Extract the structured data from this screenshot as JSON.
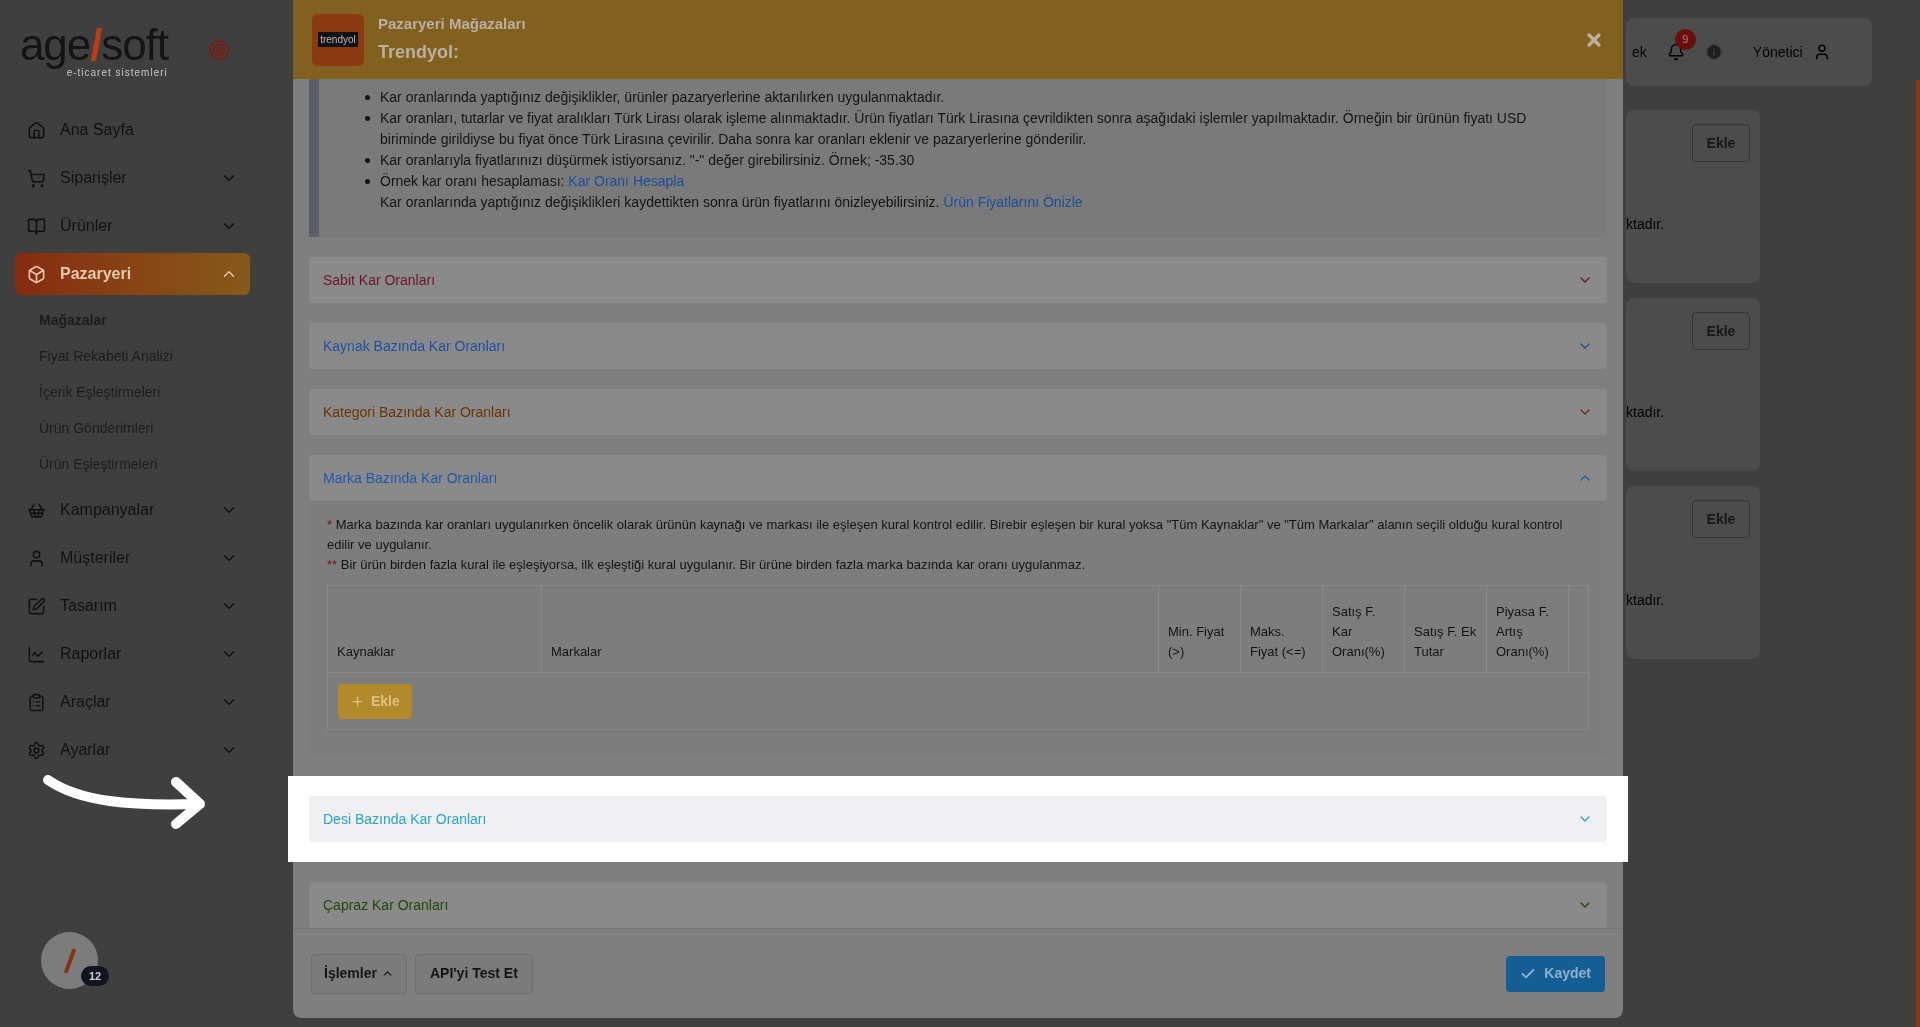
{
  "sidebar": {
    "logo": {
      "part_1": "age",
      "slash": "/",
      "part_2": "soft",
      "tagline": "e-ticaret sistemleri"
    },
    "items": [
      {
        "label": "Ana Sayfa",
        "kind": "link",
        "selected": false
      },
      {
        "label": "Siparişler",
        "kind": "group",
        "selected": false,
        "expanded": false
      },
      {
        "label": "Ürünler",
        "kind": "group",
        "selected": false,
        "expanded": false
      },
      {
        "label": "Pazaryeri",
        "kind": "group",
        "selected": true,
        "expanded": true,
        "children": [
          {
            "label": "Mağazalar",
            "selected": true
          },
          {
            "label": "Fiyat Rekabeti Analizi",
            "selected": false
          },
          {
            "label": "İçerik Eşleştirmeleri",
            "selected": false
          },
          {
            "label": "Ürün Gönderimleri",
            "selected": false
          },
          {
            "label": "Ürün Eşleştirmeleri",
            "selected": false
          }
        ]
      },
      {
        "label": "Kampanyalar",
        "kind": "group",
        "selected": false,
        "expanded": false
      },
      {
        "label": "Müşteriler",
        "kind": "group",
        "selected": false,
        "expanded": false
      },
      {
        "label": "Tasarım",
        "kind": "group",
        "selected": false,
        "expanded": false
      },
      {
        "label": "Raporlar",
        "kind": "group",
        "selected": false,
        "expanded": false
      },
      {
        "label": "Araçlar",
        "kind": "group",
        "selected": false,
        "expanded": false
      },
      {
        "label": "Ayarlar",
        "kind": "group",
        "selected": false,
        "expanded": false
      }
    ]
  },
  "floating_widget": {
    "badge": "12"
  },
  "background_page": {
    "topbar": {
      "cut_text": "ek",
      "notification_count": "9",
      "user": "Yönetici"
    },
    "cards": [
      {
        "button": "Ekle",
        "cut_text": "ktadır."
      },
      {
        "button": "Ekle",
        "cut_text": "ktadır."
      },
      {
        "button": "Ekle",
        "cut_text": "ktadır."
      }
    ]
  },
  "modal": {
    "logo_text": "trendyol",
    "subtitle": "Pazaryeri Mağazaları",
    "title": "Trendyol:",
    "notes": [
      {
        "lines": [
          {
            "text": "Kar oranlarında yaptığınız değişiklikler, ürünler pazaryerlerine aktarılırken uygulanmaktadır."
          }
        ]
      },
      {
        "lines": [
          {
            "text": "Kar oranları, tutarlar ve fiyat aralıkları Türk Lirası olarak işleme alınmaktadır. Ürün fiyatları Türk Lirasına çevrildikten sonra aşağıdaki işlemler yapılmaktadır. Örneğin bir ürünün fiyatı USD biriminde girildiyse bu fiyat önce Türk Lirasına çevirilir. Daha sonra kar oranları eklenir ve pazaryerlerine gönderilir."
          }
        ]
      },
      {
        "lines": [
          {
            "text": "Kar oranlarıyla fiyatlarınızı düşürmek istiyorsanız. \"-\" değer girebilirsiniz. Örnek; -35.30"
          }
        ]
      },
      {
        "lines": [
          {
            "text": "Örnek kar oranı hesaplaması:",
            "link": "Kar Oranı Hesapla"
          },
          {
            "text": "Kar oranlarında yaptığınız değişiklikleri kaydettikten sonra ürün fiyatlarını önizleyebilirsiniz.",
            "link": "Ürün Fiyatlarını Önizle"
          }
        ]
      }
    ],
    "sections": [
      {
        "title": "Sabit Kar Oranları",
        "color": "#6e1428",
        "expanded": false,
        "highlighted": false
      },
      {
        "title": "Kaynak Bazında Kar Oranları",
        "color": "#1f4f9e",
        "expanded": false,
        "highlighted": false
      },
      {
        "title": "Kategori Bazında Kar Oranları",
        "color": "#6a3300",
        "expanded": false,
        "highlighted": false
      },
      {
        "title": "Marka Bazında Kar Oranları",
        "color": "#1f58ad",
        "expanded": true,
        "highlighted": false,
        "notes": [
          {
            "mark": "*",
            "text": "Marka bazında kar oranları uygulanırken öncelik olarak ürünün kaynağı ve markası ile eşleşen kural kontrol edilir. Birebir eşleşen bir kural yoksa \"Tüm Kaynaklar\" ve \"Tüm Markalar\" alanın seçili olduğu kural kontrol edilir ve uygulanır."
          },
          {
            "mark": "**",
            "text": "Bir ürün birden fazla kural ile eşleşiyorsa, ilk eşleştiği kural uygulanır. Bir ürüne birden fazla marka bazında kar oranı uygulanmaz."
          }
        ],
        "table": {
          "columns": [
            "Kaynaklar",
            "Markalar",
            "Min. Fiyat (>)",
            "Maks. Fiyat (<=)",
            "Satış F. Kar Oranı(%)",
            "Satış F. Ek Tutar",
            "Piyasa F. Artış Oranı(%)"
          ],
          "add_button": "Ekle"
        }
      },
      {
        "title": "Desi Bazında Kar Oranları",
        "color": "#25a7c0",
        "expanded": false,
        "highlighted": true
      },
      {
        "title": "Çapraz Kar Oranları",
        "color": "#1f4a06",
        "expanded": false,
        "highlighted": false
      }
    ],
    "footer": {
      "actions_button": "İşlemler",
      "test_button": "API'yi Test Et",
      "save_button": "Kaydet"
    }
  }
}
